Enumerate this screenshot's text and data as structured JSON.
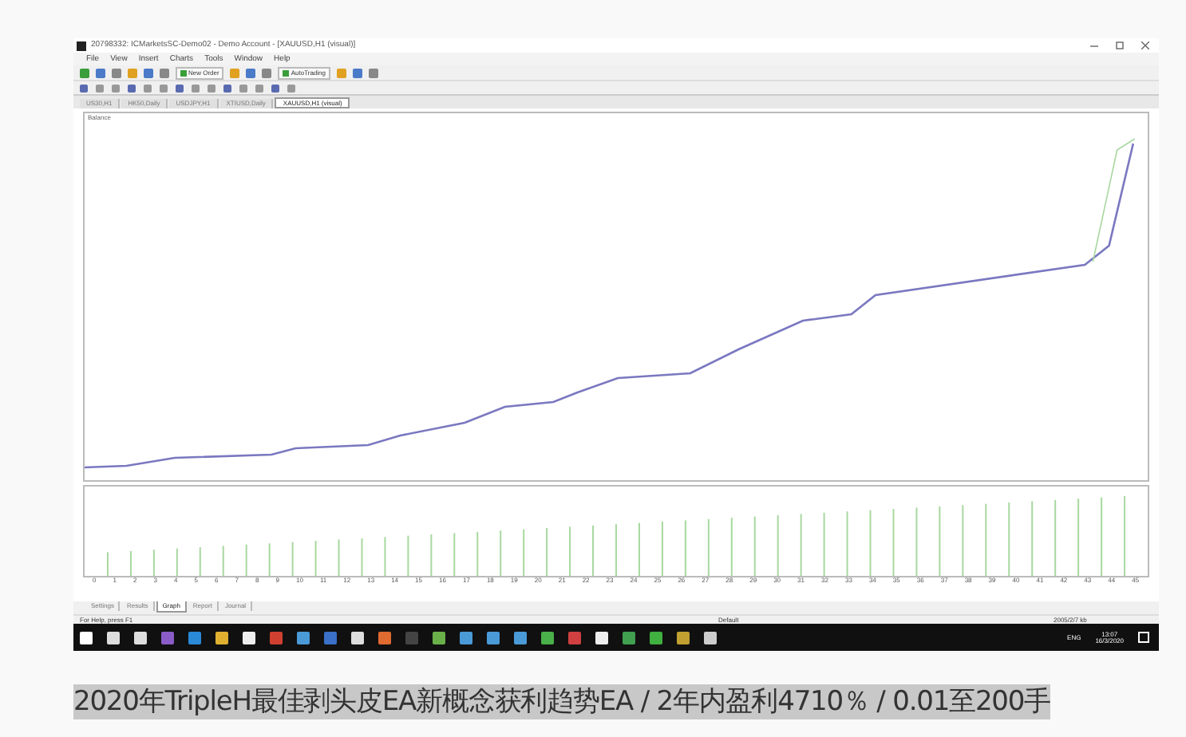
{
  "window": {
    "title": "20798332: ICMarketsSC-Demo02 - Demo Account - [XAUUSD,H1 (visual)]"
  },
  "menu": [
    "File",
    "View",
    "Insert",
    "Charts",
    "Tools",
    "Window",
    "Help"
  ],
  "toolbar": {
    "buttons": [
      "New Order",
      "AutoTrading"
    ]
  },
  "chart_tabs": [
    {
      "label": "US30,H1",
      "selected": false
    },
    {
      "label": "HK50,Daily",
      "selected": false
    },
    {
      "label": "USDJPY,H1",
      "selected": false
    },
    {
      "label": "XTIUSD,Daily",
      "selected": false
    },
    {
      "label": "XAUUSD,H1 (visual)",
      "selected": true
    }
  ],
  "graph": {
    "label": "Balance",
    "x_axis_labels": [
      "0",
      "1",
      "2",
      "3",
      "4",
      "5",
      "6",
      "7",
      "8",
      "9",
      "10",
      "11",
      "12",
      "13",
      "14",
      "15",
      "16",
      "17",
      "18",
      "19",
      "20",
      "21",
      "22",
      "23",
      "24",
      "25",
      "26",
      "27",
      "28",
      "29",
      "30",
      "31",
      "32",
      "33",
      "34",
      "35",
      "36",
      "37",
      "38",
      "39",
      "40",
      "41",
      "42",
      "43",
      "44",
      "45"
    ]
  },
  "tester_tabs": [
    {
      "label": "Settings",
      "selected": false
    },
    {
      "label": "Results",
      "selected": false
    },
    {
      "label": "Graph",
      "selected": true
    },
    {
      "label": "Report",
      "selected": false
    },
    {
      "label": "Journal",
      "selected": false
    }
  ],
  "status_bar": {
    "help": "For Help, press F1",
    "profile": "Default",
    "traffic": "2005/2/7 kb"
  },
  "taskbar": {
    "language": "ENG",
    "time": "13:07",
    "date": "16/3/2020"
  },
  "caption": "2020年TripleH最佳剥头皮EA新概念获利趋势EA / 2年内盈利4710％ / 0.01至200手"
}
